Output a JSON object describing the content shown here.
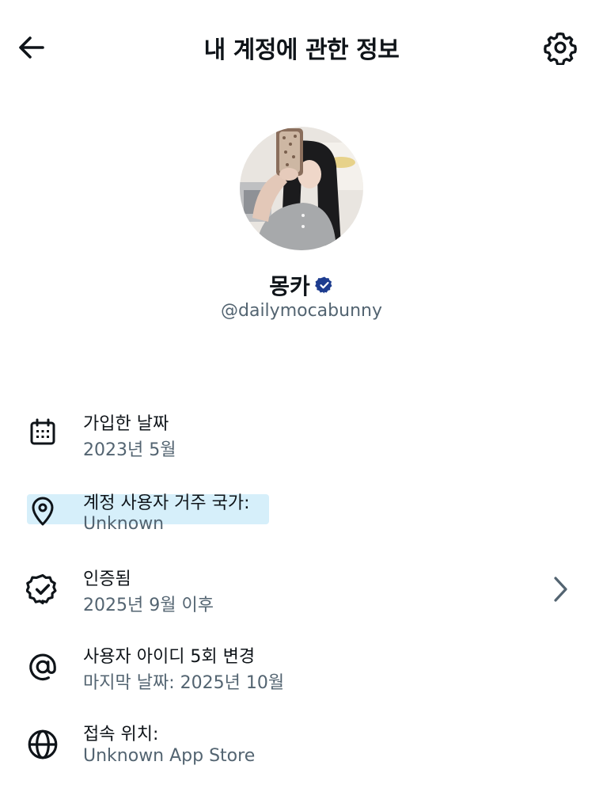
{
  "header": {
    "title": "내 계정에 관한 정보",
    "back_icon": "arrow-left-icon",
    "settings_icon": "gear-icon"
  },
  "profile": {
    "display_name": "몽카",
    "handle": "@dailymocabunny",
    "verified_icon": "verified-badge-icon",
    "verified_color": "#1d3c8f"
  },
  "rows": [
    {
      "icon": "calendar-icon",
      "label": "가입한 날짜",
      "value": "2023년 5월"
    },
    {
      "icon": "location-pin-icon",
      "label": "계정 사용자 거주 국가:",
      "value": "Unknown"
    },
    {
      "icon": "verified-check-icon",
      "label": "인증됨",
      "value": "2025년 9월 이후"
    },
    {
      "icon": "at-sign-icon",
      "label": "사용자 아이디 5회 변경",
      "value": "마지막 날짜: 2025년 10월"
    },
    {
      "icon": "globe-icon",
      "label": "접속 위치:",
      "value": "Unknown App Store"
    }
  ],
  "colors": {
    "text_primary": "#0f1419",
    "text_secondary": "#536471",
    "highlight": "#cdebfa"
  }
}
